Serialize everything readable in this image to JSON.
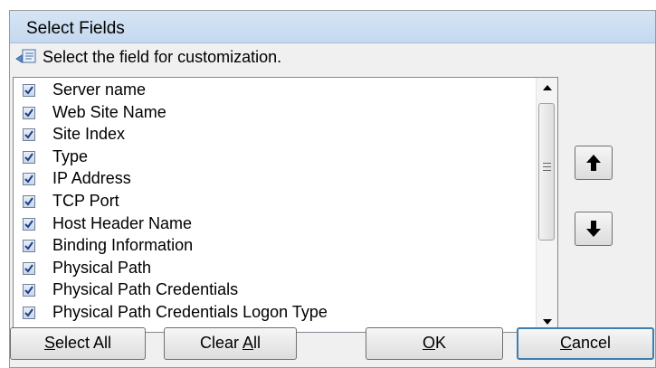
{
  "dialog": {
    "title": "Select Fields",
    "instruction": "Select the field for customization."
  },
  "fields": [
    {
      "label": "Server name",
      "checked": true
    },
    {
      "label": "Web Site Name",
      "checked": true
    },
    {
      "label": "Site Index",
      "checked": true
    },
    {
      "label": "Type",
      "checked": true
    },
    {
      "label": "IP Address",
      "checked": true
    },
    {
      "label": "TCP Port",
      "checked": true
    },
    {
      "label": "Host Header Name",
      "checked": true
    },
    {
      "label": "Binding Information",
      "checked": true
    },
    {
      "label": "Physical Path",
      "checked": true
    },
    {
      "label": "Physical Path Credentials",
      "checked": true
    },
    {
      "label": "Physical Path Credentials Logon Type",
      "checked": true
    }
  ],
  "buttons": {
    "move_up_icon": "arrow-up-icon",
    "move_down_icon": "arrow-down-icon",
    "select_all": {
      "pre": "",
      "mnemonic": "S",
      "post": "elect All"
    },
    "clear_all": {
      "pre": "Clear ",
      "mnemonic": "A",
      "post": "ll"
    },
    "ok": {
      "pre": "",
      "mnemonic": "O",
      "post": "K"
    },
    "cancel": {
      "pre": "",
      "mnemonic": "C",
      "post": "ancel"
    }
  },
  "colors": {
    "titlebar": "#c4d8ee",
    "default_button_border": "#3c7fb1"
  }
}
